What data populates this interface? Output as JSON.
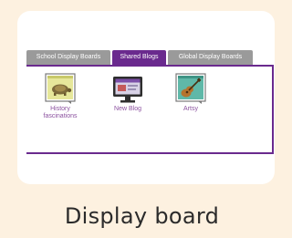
{
  "tabs": [
    {
      "label": "School Display Boards",
      "active": false
    },
    {
      "label": "Shared Blogs",
      "active": true
    },
    {
      "label": "Global Display Boards",
      "active": false
    }
  ],
  "blogs": [
    {
      "label": "History fascinations",
      "icon": "turtle-poster-icon"
    },
    {
      "label": "New Blog",
      "icon": "monitor-icon"
    },
    {
      "label": "Artsy",
      "icon": "guitar-poster-icon"
    }
  ],
  "caption": "Display board",
  "colors": {
    "background": "#fdf1e0",
    "accent": "#6a2a8e",
    "inactive_tab": "#9a9a9a",
    "link": "#8a4f9e"
  }
}
